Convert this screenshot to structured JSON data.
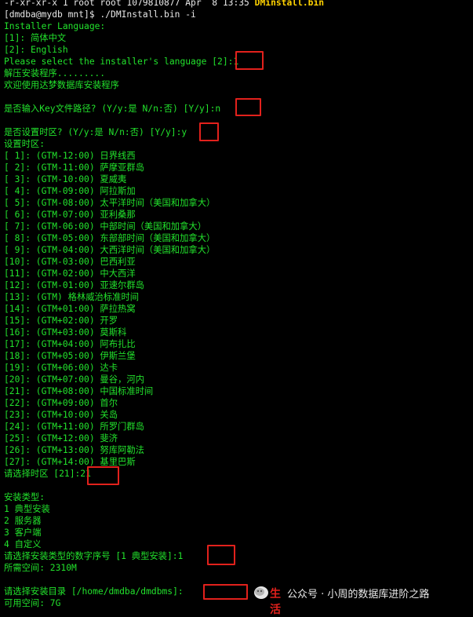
{
  "terminal": {
    "lines": [
      "-r-xr-xr-x 1 root root 1079810877 Apr  8 13:35 ",
      "[dmdba@mydb mnt]$ ./DMInstall.bin -i",
      "Installer Language:",
      "[1]: 简体中文",
      "[2]: English",
      "Please select the installer's language [2]:1",
      "解压安装程序.........",
      "欢迎使用达梦数据库安装程序",
      "",
      "是否输入Key文件路径? (Y/y:是 N/n:否) [Y/y]:n",
      "",
      "是否设置时区? (Y/y:是 N/n:否) [Y/y]:y",
      "设置时区:",
      "[ 1]: (GTM-12:00) 日界线西",
      "[ 2]: (GTM-11:00) 萨摩亚群岛",
      "[ 3]: (GTM-10:00) 夏威夷",
      "[ 4]: (GTM-09:00) 阿拉斯加",
      "[ 5]: (GTM-08:00) 太平洋时间（美国和加拿大）",
      "[ 6]: (GTM-07:00) 亚利桑那",
      "[ 7]: (GTM-06:00) 中部时间（美国和加拿大）",
      "[ 8]: (GTM-05:00) 东部部时间（美国和加拿大）",
      "[ 9]: (GTM-04:00) 大西洋时间（美国和加拿大）",
      "[10]: (GTM-03:00) 巴西利亚",
      "[11]: (GTM-02:00) 中大西洋",
      "[12]: (GTM-01:00) 亚速尔群岛",
      "[13]: (GTM) 格林威治标准时间",
      "[14]: (GTM+01:00) 萨拉热窝",
      "[15]: (GTM+02:00) 开罗",
      "[16]: (GTM+03:00) 莫斯科",
      "[17]: (GTM+04:00) 阿布扎比",
      "[18]: (GTM+05:00) 伊斯兰堡",
      "[19]: (GTM+06:00) 达卡",
      "[20]: (GTM+07:00) 曼谷，河内",
      "[21]: (GTM+08:00) 中国标准时间",
      "[22]: (GTM+09:00) 首尔",
      "[23]: (GTM+10:00) 关岛",
      "[24]: (GTM+11:00) 所罗门群岛",
      "[25]: (GTM+12:00) 斐济",
      "[26]: (GTM+13:00) 努库阿勒法",
      "[27]: (GTM+14:00) 基里巴斯",
      "请选择时区 [21]:21",
      "",
      "安装类型:",
      "1 典型安装",
      "2 服务器",
      "3 客户端",
      "4 自定义",
      "请选择安装类型的数字序号 [1 典型安装]:1",
      "所需空间: 2310M",
      "",
      "请选择安装目录 [/home/dmdba/dmdbms]:",
      "可用空间: 7G"
    ],
    "file_name": "DMinstall.bin"
  },
  "watermark": {
    "brand_text": "公众号 · 小周的数据库进阶之路",
    "logo_text": "生活"
  },
  "colors": {
    "background": "#000000",
    "text": "#22e22c",
    "highlight_box": "#e2211c",
    "filename": "#ffd200"
  }
}
